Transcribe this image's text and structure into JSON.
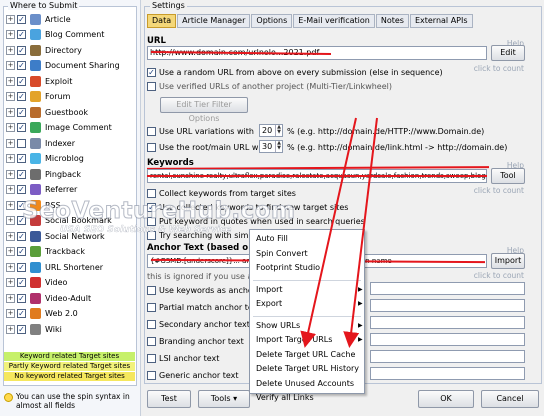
{
  "left_panel": {
    "title": "Where to Submit",
    "items": [
      {
        "label": "Article",
        "checked": true,
        "icon_color": "#6b8fc9"
      },
      {
        "label": "Blog Comment",
        "checked": true,
        "icon_color": "#4aa3df"
      },
      {
        "label": "Directory",
        "checked": true,
        "icon_color": "#8a6d3b"
      },
      {
        "label": "Document Sharing",
        "checked": true,
        "icon_color": "#3d7dc8"
      },
      {
        "label": "Exploit",
        "checked": true,
        "icon_color": "#d84a2a"
      },
      {
        "label": "Forum",
        "checked": true,
        "icon_color": "#e3a32a"
      },
      {
        "label": "Guestbook",
        "checked": true,
        "icon_color": "#b86b2c"
      },
      {
        "label": "Image Comment",
        "checked": true,
        "icon_color": "#3aa85a"
      },
      {
        "label": "Indexer",
        "checked": false,
        "icon_color": "#7a8aa8"
      },
      {
        "label": "Microblog",
        "checked": true,
        "icon_color": "#49b4e6"
      },
      {
        "label": "Pingback",
        "checked": true,
        "icon_color": "#6d6d6d"
      },
      {
        "label": "Referrer",
        "checked": true,
        "icon_color": "#7c5cc4"
      },
      {
        "label": "RSS",
        "checked": true,
        "icon_color": "#f08a1c"
      },
      {
        "label": "Social Bookmark",
        "checked": true,
        "icon_color": "#c43b3b"
      },
      {
        "label": "Social Network",
        "checked": true,
        "icon_color": "#3b5998"
      },
      {
        "label": "Trackback",
        "checked": true,
        "icon_color": "#5a9e3a"
      },
      {
        "label": "URL Shortener",
        "checked": true,
        "icon_color": "#2f8fd0"
      },
      {
        "label": "Video",
        "checked": true,
        "icon_color": "#d02f2f"
      },
      {
        "label": "Video-Adult",
        "checked": true,
        "icon_color": "#b0306b"
      },
      {
        "label": "Web 2.0",
        "checked": true,
        "icon_color": "#e07b1f"
      },
      {
        "label": "Wiki",
        "checked": true,
        "icon_color": "#808080"
      }
    ],
    "legend": [
      {
        "label": "Keyword related Target sites",
        "color": "#c6f06a"
      },
      {
        "label": "Partly Keyword related Target sites",
        "color": "#f2f27a"
      },
      {
        "label": "No keyword related Target sites",
        "color": "#f5e75e"
      }
    ],
    "hint": "You can use the spin syntax in almost all fields"
  },
  "settings": {
    "title": "Settings",
    "tabs": [
      "Data",
      "Article Manager",
      "Options",
      "E-Mail verification",
      "Notes",
      "External APIs"
    ],
    "active_tab": "Data",
    "url_section": {
      "label": "URL",
      "help": "Help",
      "click_to_count": "click to count",
      "value": "http://www.domain.com/urlnolo...2021.pdf",
      "edit_button": "Edit",
      "opt_random": "Use a random URL from above on every submission (else in sequence)",
      "opt_verified": "Use verified URLs of another project (Multi-Tier/Linkwheel)",
      "edit_filter_button": "Edit Tier Filter Options",
      "opt_variations": "Use URL variations with",
      "variations_value": "20",
      "variations_hint": "% (e.g. http://domain.de/HTTP://www.Domain.de)",
      "opt_root": "Use the root/main URL with",
      "root_value": "30",
      "root_hint": "% (e.g. http://domain.de/link.html -> http://domain.de)"
    },
    "keywords_section": {
      "label": "Keywords",
      "help": "Help",
      "click_to_count": "click to count",
      "value": "rental,sunshine realty,ultraflex,paradise,ralestate,acquasun,yardsale,fashion,trends,sweep,blog,flatbed,handcrafts,broadening,Sy",
      "tool_button": "Tool",
      "opt_collect": "Collect keywords from target sites",
      "opt_use_collected": "Use collected keywords to find new target sites",
      "opt_put_keyword": "Put keyword in quotes when used in search queries",
      "opt_try_search": "Try searching with similar..."
    },
    "anchor_section": {
      "label": "Anchor Text (based o",
      "help": "Help",
      "click_to_count": "click to count",
      "value": "{#GSMD:[underscore]}... anchor text sites|underscore sites in name",
      "import_button": "Import",
      "ignore_note": "this is ignored if you use an",
      "opt_keywords_anchor": "Use keywords as anchor",
      "opt_partial": "Partial match anchor text",
      "opt_secondary": "Secondary anchor text",
      "opt_branding": "Branding anchor text",
      "opt_lsi": "LSI anchor text",
      "opt_generic": "Generic anchor text"
    }
  },
  "context_menu": {
    "items": [
      {
        "label": "Auto Fill",
        "sub": false
      },
      {
        "label": "Spin Convert",
        "sub": false
      },
      {
        "label": "Footprint Studio",
        "sub": false
      },
      {
        "sep": true
      },
      {
        "label": "Import",
        "sub": true
      },
      {
        "label": "Export",
        "sub": true
      },
      {
        "sep": true
      },
      {
        "label": "Show URLs",
        "sub": true
      },
      {
        "label": "Import Target URLs",
        "sub": true
      },
      {
        "label": "Delete Target URL Cache",
        "sub": false
      },
      {
        "label": "Delete Target URL History",
        "sub": false
      },
      {
        "label": "Delete Unused Accounts",
        "sub": false
      },
      {
        "label": "Verify all Links",
        "sub": false
      }
    ]
  },
  "bottom": {
    "test": "Test",
    "tools": "Tools",
    "ok": "OK",
    "cancel": "Cancel"
  },
  "watermark": {
    "main": "SeoVentureHub.com",
    "sub": "USA SEO Solutions & Web Service"
  },
  "colors": {
    "active_tab": "#f4d779",
    "annotation_red": "#e4161c"
  }
}
